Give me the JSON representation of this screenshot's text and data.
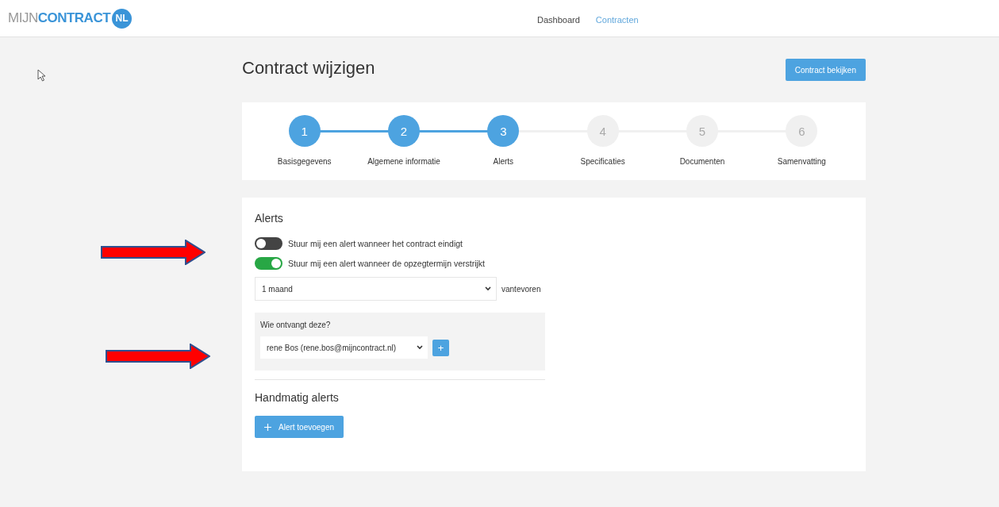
{
  "logo": {
    "prefix": "MIJN",
    "name": "CONTRACT",
    "badge": "NL"
  },
  "nav": [
    {
      "label": "Dashboard",
      "selected": false
    },
    {
      "label": "Contracten",
      "selected": true
    }
  ],
  "page_title": "Contract wijzigen",
  "view_button": "Contract bekijken",
  "steps": [
    {
      "number": "1",
      "label": "Basisgegevens",
      "reached": true
    },
    {
      "number": "2",
      "label": "Algemene informatie",
      "reached": true
    },
    {
      "number": "3",
      "label": "Alerts",
      "reached": true
    },
    {
      "number": "4",
      "label": "Specificaties",
      "reached": false
    },
    {
      "number": "5",
      "label": "Documenten",
      "reached": false
    },
    {
      "number": "6",
      "label": "Samenvatting",
      "reached": false
    }
  ],
  "alerts": {
    "heading": "Alerts",
    "toggles": [
      {
        "label": "Stuur mij een alert wanneer het contract eindigt",
        "on": false
      },
      {
        "label": "Stuur mij een alert wanneer de opzegtermijn verstrijkt",
        "on": true
      }
    ],
    "period": {
      "value": "1 maand",
      "suffix": "vantevoren"
    },
    "recipients": {
      "label": "Wie ontvangt deze?",
      "value": "rene Bos (rene.bos@mijncontract.nl)",
      "add_button": "+"
    }
  },
  "manual": {
    "heading": "Handmatig alerts",
    "add_button": "Alert toevoegen"
  }
}
